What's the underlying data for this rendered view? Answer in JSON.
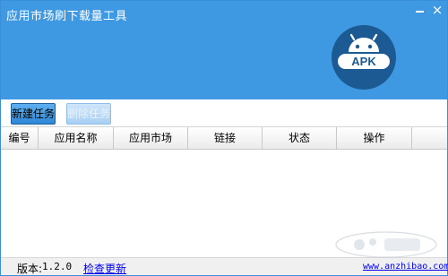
{
  "window": {
    "title": "应用市场刷下载量工具",
    "minimize_icon": "minimize-icon",
    "close_icon": "close-icon",
    "close_glyph": "×"
  },
  "logo": {
    "icon": "android-apk-icon",
    "text": "APK"
  },
  "toolbar": {
    "new_task_label": "新建任务",
    "delete_task_label": "删除任务"
  },
  "table": {
    "columns": [
      "编号",
      "应用名称",
      "应用市场",
      "链接",
      "状态",
      "操作",
      ""
    ],
    "rows": []
  },
  "status_bar": {
    "version_label": "版本:",
    "version_value": "1.2.0",
    "check_update_label": "检查更新",
    "website": "www.anzhibao.com"
  },
  "watermark": {
    "icon": "baidu-jingyan-watermark"
  },
  "colors": {
    "header_bg": "#3f99e2",
    "button_primary": "#2d86d6",
    "link": "#0000ee"
  }
}
